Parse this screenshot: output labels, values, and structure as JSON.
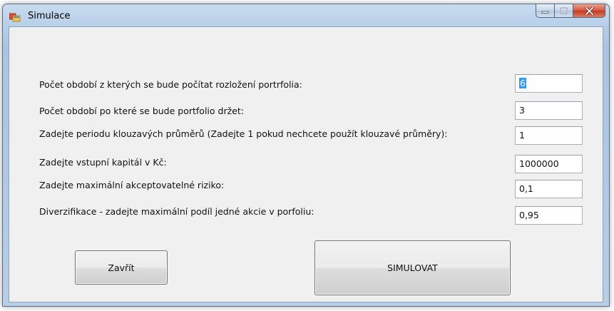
{
  "window": {
    "title": "Simulace",
    "controls": {
      "minimize_icon": "minimize-icon",
      "maximize_icon": "maximize-icon",
      "close_icon": "close-icon"
    }
  },
  "form": {
    "fields": [
      {
        "label": "Počet období z kterých se bude počítat rozložení portrfolia:",
        "value": "6"
      },
      {
        "label": "Počet období po které se bude portfolio držet:",
        "value": "3"
      },
      {
        "label": "Zadejte periodu klouzavých průměrů (Zadejte 1 pokud nechcete použít klouzavé průměry):",
        "value": "1"
      },
      {
        "label": "Zadejte vstupní kapitál v Kč:",
        "value": "1000000"
      },
      {
        "label": "Zadejte maximální akceptovatelné riziko:",
        "value": "0,1"
      },
      {
        "label": "Diverzifikace - zadejte maximální podíl jedné akcie v porfoliu:",
        "value": "0,95"
      }
    ]
  },
  "buttons": {
    "close_label": "Zavřít",
    "simulate_label": "SIMULOVAT"
  },
  "colors": {
    "title_bar": "#b7cfe8",
    "close_button": "#c23a21",
    "selection": "#3399ff",
    "client_background": "#f0f0f0"
  }
}
